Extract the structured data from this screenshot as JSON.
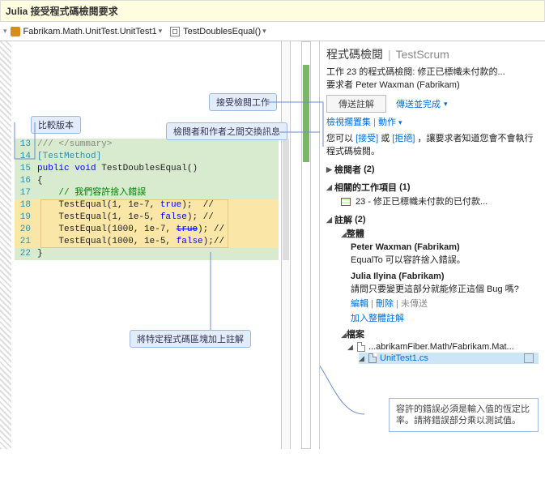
{
  "title_bar": "Julia 接受程式碼檢閱要求",
  "tabs": {
    "file": "Fabrikam.Math.UnitTest.UnitTest1",
    "member": "TestDoublesEqual()"
  },
  "callouts": {
    "compare_versions": "比較版本",
    "accept_review": "接受檢閱工作",
    "exchange_msgs": "檢閱者和作者之間交換訊息",
    "annotate_block": "將特定程式碼區塊加上註解"
  },
  "code": {
    "l13": "/// </summary>",
    "l14": "[TestMethod]",
    "l15a": "public",
    "l15b": " void",
    "l15c": " TestDoublesEqual()",
    "l16": "{",
    "l17": "    // 我們容許捨入錯誤",
    "l18a": "    TestEqual(1, 1e-7, ",
    "l18b": "true",
    "l18c": ");  //",
    "l19a": "    TestEqual(1, 1e-5, ",
    "l19b": "false",
    "l19c": "); //",
    "l20a": "    TestEqual(1000, 1e-7, ",
    "l20b": "true",
    "l20c": "); //",
    "l21a": "    TestEqual(1000, 1e-5, ",
    "l21b": "false",
    "l21c": ");//",
    "l22": "}"
  },
  "linenos": {
    "13": "13",
    "14": "14",
    "15": "15",
    "16": "16",
    "17": "17",
    "18": "18",
    "19": "19",
    "20": "20",
    "21": "21",
    "22": "22"
  },
  "review": {
    "header": "程式碼檢閱",
    "subheader": "TestScrum",
    "work_desc": "工作 23 的程式碼檢閱: 修正已標幟未付款的...",
    "requester_lbl": "要求者",
    "requester_name": "Peter Waxman (Fabrikam)",
    "send_comment_btn": "傳送註解",
    "send_complete": "傳送並完成",
    "shelveset_link": "檢視擱置集",
    "actions_link": "動作",
    "accept_reject_pre": "您可以",
    "accept": "[接受]",
    "or": "或",
    "reject": "[拒絕]",
    "accept_reject_post": "，讓要求者知道您會不會執行程式碼檢閱。",
    "reviewers_head": "檢閱者",
    "reviewers_count": "(2)",
    "related_head": "相關的工作項目",
    "related_count": "(1)",
    "related_item": "23 - 修正已標幟未付款的已付款...",
    "comments_head": "註解",
    "comments_count": "(2)",
    "overall": "整體",
    "author1": "Peter Waxman (Fabrikam)",
    "msg1": "EqualTo 可以容許捨入錯誤。",
    "author2": "Julia Ilyina (Fabrikam)",
    "msg2": "請問只要變更這部分就能修正這個 Bug 嗎?",
    "edit": "編輯",
    "delete": "刪除",
    "unsent": "未傳送",
    "add_overall": "加入整體註解",
    "files_head": "檔案",
    "folder": "...abrikamFiber.Math/Fabrikam.Mat...",
    "file": "UnitTest1.cs",
    "tooltip": "容許的錯誤必須是輸入值的恆定比率。請將錯誤部分乘以測試值。"
  }
}
